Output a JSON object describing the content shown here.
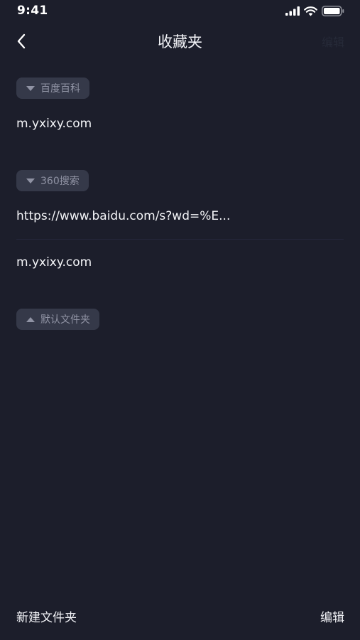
{
  "status_bar": {
    "time": "9:41"
  },
  "nav": {
    "title": "收藏夹",
    "right_label": "编辑"
  },
  "folders": [
    {
      "name": "百度百科",
      "expanded": true,
      "items": [
        "m.yxixy.com"
      ]
    },
    {
      "name": "360搜索",
      "expanded": true,
      "items": [
        "https://www.baidu.com/s?wd=%E...",
        "m.yxixy.com"
      ]
    },
    {
      "name": "默认文件夹",
      "expanded": false,
      "items": []
    }
  ],
  "bottom_bar": {
    "new_folder_label": "新建文件夹",
    "edit_label": "编辑"
  },
  "icons": {
    "back": "chevron-left-icon",
    "signal": "signal-icon",
    "wifi": "wifi-icon",
    "battery": "battery-icon"
  },
  "colors": {
    "background": "#1c1e2b",
    "chip_background": "#353949",
    "chip_text": "#9093a4",
    "text": "#f2f3f7"
  }
}
